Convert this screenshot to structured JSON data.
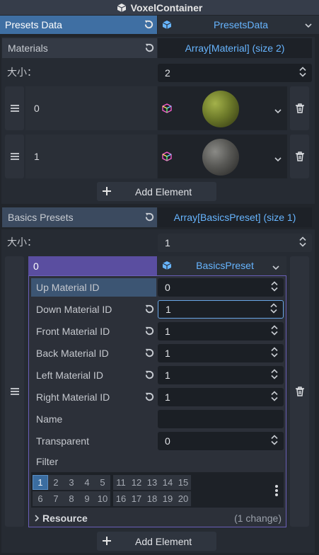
{
  "window": {
    "title": "VoxelContainer"
  },
  "presets_data": {
    "label": "Presets Data",
    "value": "PresetsData"
  },
  "materials": {
    "label": "Materials",
    "value": "Array[Material] (size 2)",
    "size_label": "大小：",
    "size_value": "2",
    "items": [
      {
        "index": "0",
        "sphere": "mossy-sphere-preview"
      },
      {
        "index": "1",
        "sphere": "stone-sphere-preview"
      }
    ],
    "add_label": "Add Element"
  },
  "basics_presets": {
    "label": "Basics Presets",
    "value": "Array[BasicsPreset] (size 1)",
    "size_label": "大小：",
    "size_value": "1",
    "element": {
      "index": "0",
      "value": "BasicsPreset",
      "props": [
        {
          "label": "Up Material ID",
          "value": "0"
        },
        {
          "label": "Down Material ID",
          "value": "1"
        },
        {
          "label": "Front Material ID",
          "value": "1"
        },
        {
          "label": "Back Material ID",
          "value": "1"
        },
        {
          "label": "Left Material ID",
          "value": "1"
        },
        {
          "label": "Right Material ID",
          "value": "1"
        }
      ],
      "name_label": "Name",
      "name_value": "",
      "transparent_label": "Transparent",
      "transparent_value": "0",
      "filter_label": "Filter",
      "layers_row1": [
        "1",
        "2",
        "3",
        "4",
        "5",
        "11",
        "12",
        "13",
        "14",
        "15"
      ],
      "layers_row2": [
        "6",
        "7",
        "8",
        "9",
        "10",
        "16",
        "17",
        "18",
        "19",
        "20"
      ],
      "resource_label": "Resource",
      "resource_changes": "(1 change)"
    },
    "add_label": "Add Element"
  },
  "colors": {
    "accent": "#3f6fa3",
    "link": "#67b5ff",
    "selected_element": "#5a4ea0"
  }
}
